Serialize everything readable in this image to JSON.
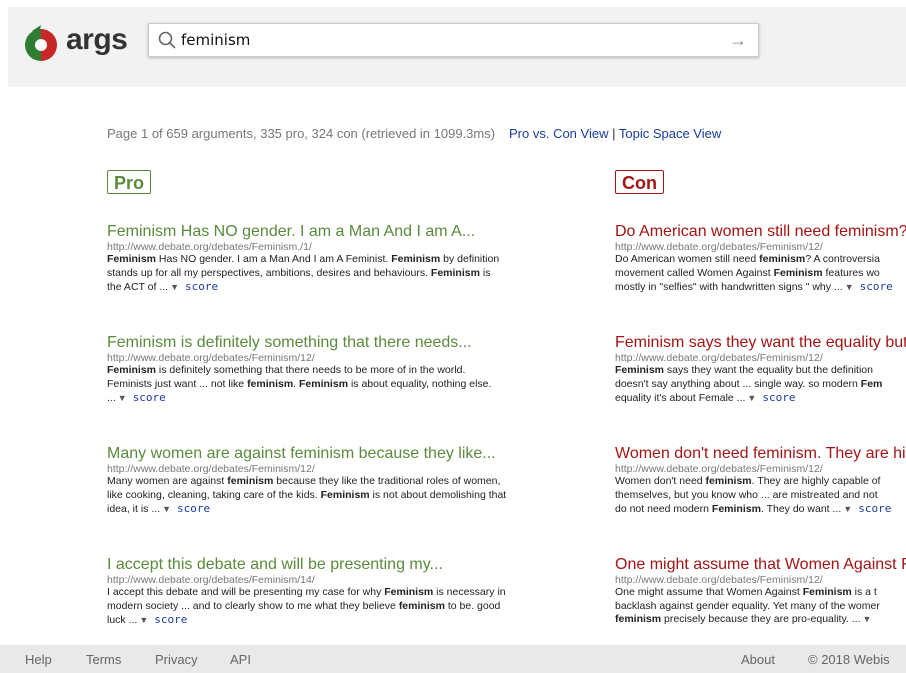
{
  "header": {
    "brand": "args",
    "search": {
      "value": "feminism",
      "placeholder": ""
    }
  },
  "summary": "Page 1 of 659 arguments, 335 pro, 324 con (retrieved in 1099.3ms)",
  "views": {
    "pro_con": "Pro vs. Con View",
    "separator": "|",
    "topic": "Topic Space View"
  },
  "pro": {
    "label": "Pro",
    "results": [
      {
        "title": "Feminism Has NO gender. I am a Man And I am A...",
        "url": "http://www.debate.org/debates/Feminism./1/",
        "snippet_html": "<b>Feminism</b> Has NO gender. I am a Man And I am A Feminist. <b>Feminism</b> by definition stands up for all my perspectives, ambitions, desires and behaviours. <b>Feminism</b> is the ACT of ..."
      },
      {
        "title": "Feminism is definitely something that there needs...",
        "url": "http://www.debate.org/debates/Feminism/12/",
        "snippet_html": "<b>Feminism</b> is definitely something that there needs to be more of in the world. Feminists just want ... not like <b>feminism</b>. <b>Feminism</b> is about equality, nothing else. ..."
      },
      {
        "title": "Many women are against feminism because they like...",
        "url": "http://www.debate.org/debates/Feminism/12/",
        "snippet_html": "Many women are against <b>feminism</b> because they like the traditional roles of women, like cooking, cleaning, taking care of the kids. <b>Feminism</b> is not about demolishing that idea, it is ..."
      },
      {
        "title": "I accept this debate and will be presenting my...",
        "url": "http://www.debate.org/debates/Feminism/14/",
        "snippet_html": "I accept this debate and will be presenting my case for why <b>Feminism</b> is necessary in modern society ... and to clearly show to me what they believe <b>feminism</b> to be. good luck ..."
      }
    ]
  },
  "con": {
    "label": "Con",
    "results": [
      {
        "title": "Do American women still need feminism?",
        "url": "http://www.debate.org/debates/Feminism/12/",
        "snippet_html": "Do American women still need <b>feminism</b>? A controversia<br>movement called Women Against <b>Feminism</b> features wo<br>mostly in \"selfies\" with handwritten signs \" why ..."
      },
      {
        "title": "Feminism says they want the equality but",
        "url": "http://www.debate.org/debates/Feminism/12/",
        "snippet_html": "<b>Feminism</b> says they want the equality but the definition<br>doesn't say anything about ... single way. so modern <b>Fem</b><br>equality it's about Female ..."
      },
      {
        "title": "Women don't need feminism. They are hig",
        "url": "http://www.debate.org/debates/Feminism/12/",
        "snippet_html": "Women don't need <b>feminism</b>. They are highly capable of<br>themselves, but you know who ... are mistreated and not<br>do not need modern <b>Feminism</b>. They do want ..."
      },
      {
        "title": "One might assume that Women Against F",
        "url": "http://www.debate.org/debates/Feminism/12/",
        "snippet_html": "One might assume that Women Against <b>Feminism</b> is a t<br>backlash against gender equality. Yet many of the womer<br><b>feminism</b> precisely because they are pro-equality. ..."
      }
    ]
  },
  "score_label": "score",
  "footer": {
    "help": "Help",
    "terms": "Terms",
    "privacy": "Privacy",
    "api": "API",
    "about": "About",
    "copyright": "© 2018 Webis"
  },
  "colors": {
    "pro": "#5a8a3c",
    "con": "#a31515",
    "link": "#1a3c9e"
  }
}
